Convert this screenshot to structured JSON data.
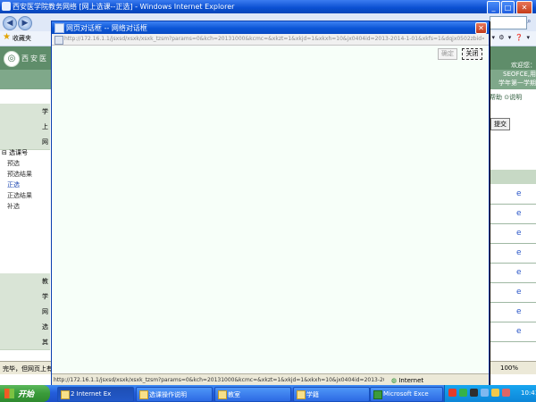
{
  "ie": {
    "title": "西安医学院教务网络 [网上选课--正选] - Windows Internet Explorer",
    "favorites_label": "收藏夹",
    "status_text": "完毕，但网页上有错误。"
  },
  "site": {
    "name": "西安医",
    "logo_char": "◎",
    "right_info": "欢迎您：\n SEOFCE,用\n学年第一学期",
    "help_label": "帮助 ⊙说明",
    "submit_label": "提交"
  },
  "left_rows": [
    "学",
    "上",
    "网",
    "教",
    "学",
    "网",
    "选",
    "其"
  ],
  "tree": {
    "root": "⊟ 选课号",
    "items": [
      "预选",
      "预选结果",
      "正选",
      "正选结果",
      "补选"
    ]
  },
  "popup": {
    "title": "网页对话框 -- 网络对话框",
    "url": "http://172.16.1.1/jsxsd/xsxk/xsxk_tzsm?params=0&kch=20131000&kcmc=&xkzt=1&xkjd=1&xkxh=10&jx0404id=2013-2014-1-01&xkfs=1&dqjx0502zbid=0&dqkbjx0404id=",
    "save_label": "确定",
    "close_label": "关闭",
    "status_url": "http://172.16.1.1/jsxsd/xsxk/xsxk_tzsm?params=0&kch=20131000&kcmc=&xkzt=1&xkjd=1&xkxh=10&jx0404id=2013-2014-1-01",
    "zone": "Internet",
    "zone_icon": "globe-icon"
  },
  "statusbar": {
    "zoom": "100%"
  },
  "taskbar": {
    "start_label": "开始",
    "tasks": [
      {
        "label": "2 Internet Ex"
      },
      {
        "label": "选课操作说明"
      },
      {
        "label": "教室"
      },
      {
        "label": "学籍"
      },
      {
        "label": "Microsoft Exce"
      }
    ],
    "clock": "10:41"
  }
}
